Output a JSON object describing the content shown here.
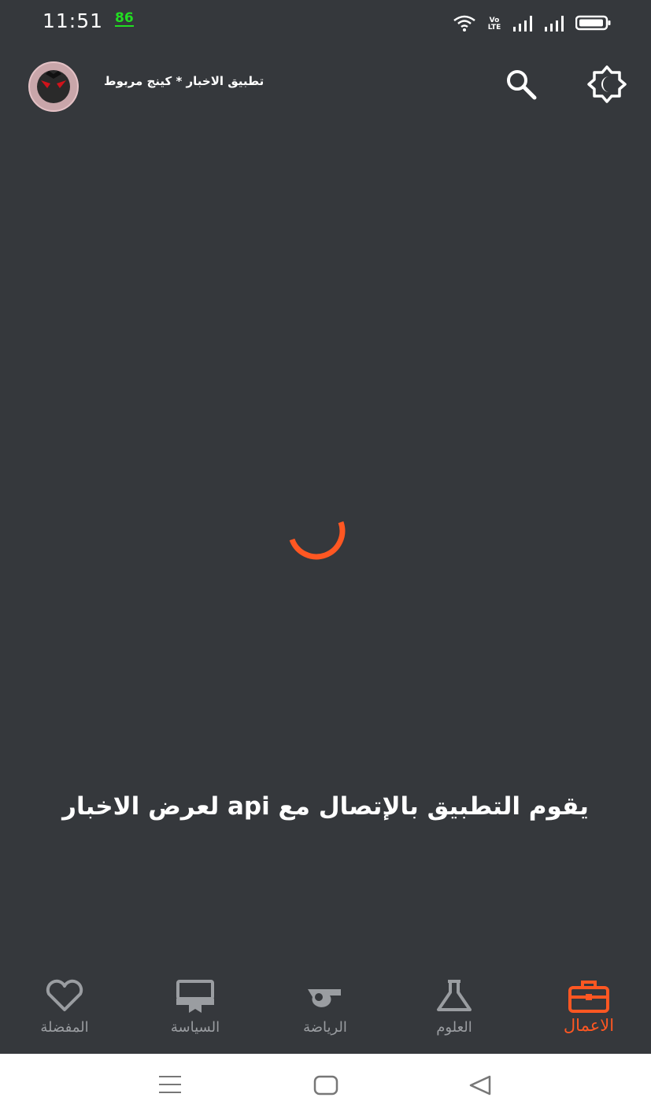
{
  "status_bar": {
    "time": "11:51",
    "battery_percent": "86",
    "network_label": "Vo\nLTE",
    "icons": [
      "wifi-icon",
      "volte-icon",
      "signal-icon",
      "signal-icon",
      "battery-icon"
    ]
  },
  "app_bar": {
    "title": "تطبيق الاخبار * كينج مربوط",
    "icons": [
      "avatar",
      "search-icon",
      "brightness-icon"
    ]
  },
  "main": {
    "loading": true,
    "message": "يقوم التطبيق بالإتصال مع api  لعرض الاخبار"
  },
  "bottom_nav": {
    "items": [
      {
        "label": "المفضلة",
        "icon": "heart-icon",
        "active": false
      },
      {
        "label": "السياسة",
        "icon": "podium-icon",
        "active": false
      },
      {
        "label": "الرياضة",
        "icon": "whistle-icon",
        "active": false
      },
      {
        "label": "العلوم",
        "icon": "flask-icon",
        "active": false
      },
      {
        "label": "الاعمال",
        "icon": "briefcase-icon",
        "active": true
      }
    ]
  },
  "system_nav": {
    "icons": [
      "menu-icon",
      "home-icon",
      "back-icon"
    ]
  },
  "colors": {
    "background": "#35383c",
    "accent": "#ff5722",
    "inactive": "#9a9da1",
    "battery_text": "#22dd22"
  }
}
